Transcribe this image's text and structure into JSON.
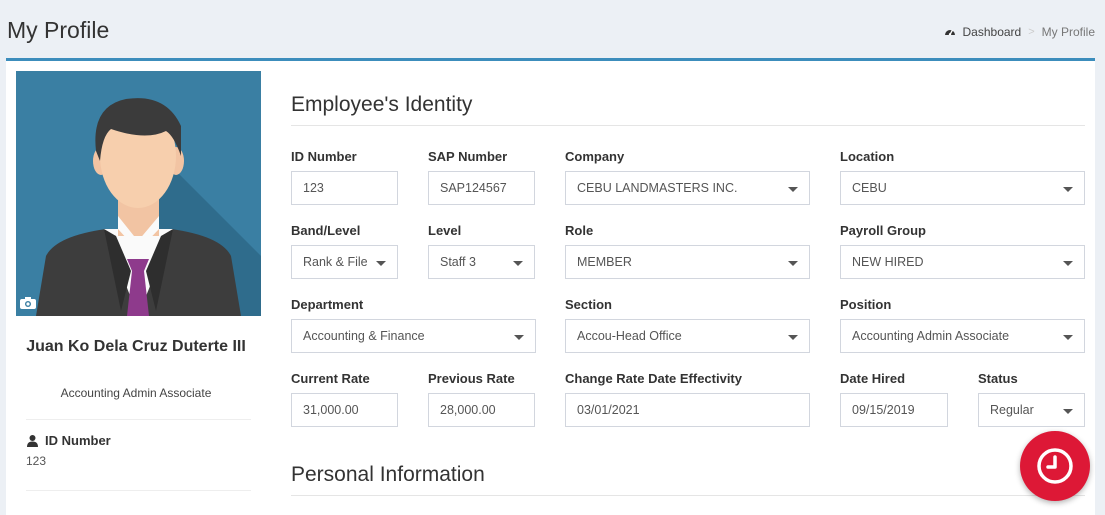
{
  "header": {
    "title": "My Profile"
  },
  "breadcrumb": {
    "icon": "dashboard-icon",
    "home": "Dashboard",
    "separator": ">",
    "current": "My Profile"
  },
  "profile": {
    "name": "Juan Ko Dela Cruz Duterte III",
    "position": "Accounting Admin Associate",
    "id_label": "ID Number",
    "id_value": "123"
  },
  "sections": {
    "identity": "Employee's Identity",
    "personal": "Personal Information"
  },
  "fields": {
    "id_number": {
      "label": "ID Number",
      "value": "123"
    },
    "sap_number": {
      "label": "SAP Number",
      "value": "SAP124567"
    },
    "company": {
      "label": "Company",
      "value": "CEBU LANDMASTERS INC."
    },
    "location": {
      "label": "Location",
      "value": "CEBU"
    },
    "band_level": {
      "label": "Band/Level",
      "value": "Rank & File"
    },
    "level": {
      "label": "Level",
      "value": "Staff 3"
    },
    "role": {
      "label": "Role",
      "value": "MEMBER"
    },
    "payroll_group": {
      "label": "Payroll Group",
      "value": "NEW HIRED"
    },
    "department": {
      "label": "Department",
      "value": "Accounting & Finance"
    },
    "section": {
      "label": "Section",
      "value": "Accou-Head Office"
    },
    "position": {
      "label": "Position",
      "value": "Accounting Admin Associate"
    },
    "current_rate": {
      "label": "Current Rate",
      "value": "31,000.00"
    },
    "previous_rate": {
      "label": "Previous Rate",
      "value": "28,000.00"
    },
    "change_rate_date": {
      "label": "Change Rate Date Effectivity",
      "value": "03/01/2021"
    },
    "date_hired": {
      "label": "Date Hired",
      "value": "09/15/2019"
    },
    "status": {
      "label": "Status",
      "value": "Regular"
    }
  },
  "colors": {
    "accent": "#3c8dbc",
    "fab": "#dd1836",
    "avatar_bg": "#3a7fa3",
    "tie": "#8e3a8c"
  },
  "icons": {
    "camera": "camera-icon",
    "user": "user-icon",
    "fab": "clock-icon",
    "caret": "caret-down-icon"
  }
}
